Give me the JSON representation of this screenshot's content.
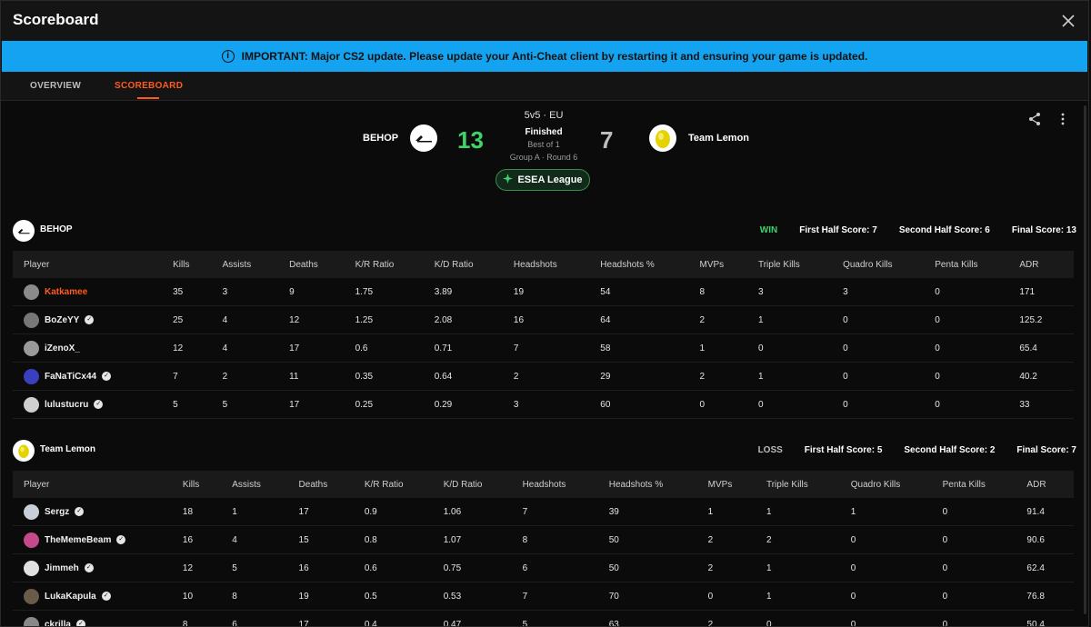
{
  "window": {
    "title": "Scoreboard"
  },
  "banner": {
    "text": "IMPORTANT: Major CS2 update. Please update your Anti-Cheat client by restarting it and ensuring your game is updated.",
    "icon": "info-icon"
  },
  "tabs": [
    {
      "label": "OVERVIEW",
      "active": false
    },
    {
      "label": "SCOREBOARD",
      "active": true
    }
  ],
  "match": {
    "team1": {
      "name": "BEHOP",
      "score": "13",
      "score_color": "#3ed46a"
    },
    "team2": {
      "name": "Team Lemon",
      "score": "7",
      "score_color": "#bdbdbd"
    },
    "format": "5v5 · EU",
    "status": "Finished",
    "best_of": "Best of 1",
    "round": "Group A · Round 6",
    "league": "ESEA League"
  },
  "columns": [
    "Player",
    "Kills",
    "Assists",
    "Deaths",
    "K/R Ratio",
    "K/D Ratio",
    "Headshots",
    "Headshots %",
    "MVPs",
    "Triple Kills",
    "Quadro Kills",
    "Penta Kills",
    "ADR"
  ],
  "teams": [
    {
      "name": "BEHOP",
      "result": "WIN",
      "first_half": "First Half Score: 7",
      "second_half": "Second Half Score: 6",
      "final": "Final Score: 13",
      "players": [
        {
          "name": "Katkamee",
          "self": true,
          "verified": false,
          "avatar": "#8a8a8a",
          "stats": [
            "35",
            "3",
            "9",
            "1.75",
            "3.89",
            "19",
            "54",
            "8",
            "3",
            "3",
            "0",
            "171"
          ]
        },
        {
          "name": "BoZeYY",
          "self": false,
          "verified": true,
          "avatar": "#777777",
          "stats": [
            "25",
            "4",
            "12",
            "1.25",
            "2.08",
            "16",
            "64",
            "2",
            "1",
            "0",
            "0",
            "125.2"
          ]
        },
        {
          "name": "iZenoX_",
          "self": false,
          "verified": false,
          "avatar": "#9a9a9a",
          "stats": [
            "12",
            "4",
            "17",
            "0.6",
            "0.71",
            "7",
            "58",
            "1",
            "0",
            "0",
            "0",
            "65.4"
          ]
        },
        {
          "name": "FaNaTiCx44",
          "self": false,
          "verified": true,
          "avatar": "#3a3fbf",
          "stats": [
            "7",
            "2",
            "11",
            "0.35",
            "0.64",
            "2",
            "29",
            "2",
            "1",
            "0",
            "0",
            "40.2"
          ]
        },
        {
          "name": "lulustucru",
          "self": false,
          "verified": true,
          "avatar": "#cfcfcf",
          "stats": [
            "5",
            "5",
            "17",
            "0.25",
            "0.29",
            "3",
            "60",
            "0",
            "0",
            "0",
            "0",
            "33"
          ]
        }
      ]
    },
    {
      "name": "Team Lemon",
      "result": "LOSS",
      "first_half": "First Half Score: 5",
      "second_half": "Second Half Score: 2",
      "final": "Final Score: 7",
      "players": [
        {
          "name": "Sergz",
          "self": false,
          "verified": true,
          "avatar": "#c9cfd8",
          "stats": [
            "18",
            "1",
            "17",
            "0.9",
            "1.06",
            "7",
            "39",
            "1",
            "1",
            "1",
            "0",
            "91.4"
          ]
        },
        {
          "name": "TheMemeBeam",
          "self": false,
          "verified": true,
          "avatar": "#c44a8a",
          "stats": [
            "16",
            "4",
            "15",
            "0.8",
            "1.07",
            "8",
            "50",
            "2",
            "2",
            "0",
            "0",
            "90.6"
          ]
        },
        {
          "name": "Jimmeh",
          "self": false,
          "verified": true,
          "avatar": "#e0e0e0",
          "stats": [
            "12",
            "5",
            "16",
            "0.6",
            "0.75",
            "6",
            "50",
            "2",
            "1",
            "0",
            "0",
            "62.4"
          ]
        },
        {
          "name": "LukaKapula",
          "self": false,
          "verified": true,
          "avatar": "#6a5a4a",
          "stats": [
            "10",
            "8",
            "19",
            "0.5",
            "0.53",
            "7",
            "70",
            "0",
            "1",
            "0",
            "0",
            "76.8"
          ]
        },
        {
          "name": "ckrilla",
          "self": false,
          "verified": true,
          "avatar": "#888888",
          "stats": [
            "8",
            "6",
            "17",
            "0.4",
            "0.47",
            "5",
            "63",
            "2",
            "0",
            "0",
            "0",
            "50.4"
          ]
        }
      ]
    }
  ],
  "colors": {
    "accent": "#ff5a1f",
    "banner": "#13a3f0",
    "win": "#3ed46a"
  }
}
